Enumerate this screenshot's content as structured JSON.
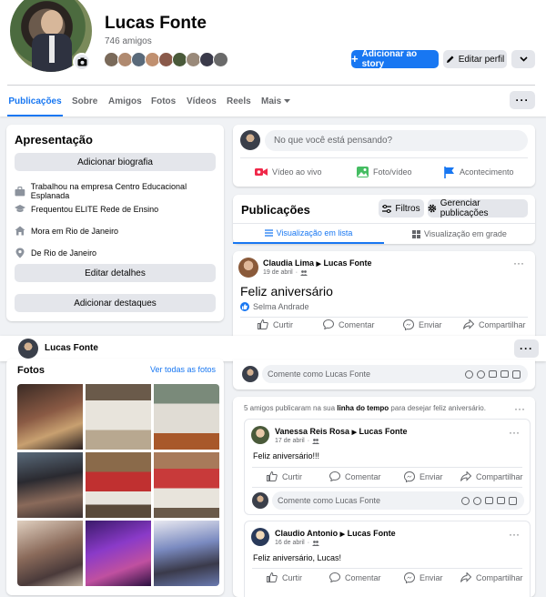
{
  "profile": {
    "name": "Lucas Fonte",
    "friends_count": "746 amigos",
    "add_story_label": "Adicionar ao story",
    "edit_profile_label": "Editar perfil"
  },
  "tabs": [
    "Publicações",
    "Sobre",
    "Amigos",
    "Fotos",
    "Vídeos",
    "Reels",
    "Mais"
  ],
  "intro": {
    "title": "Apresentação",
    "add_bio": "Adicionar biografia",
    "work_prefix": "Trabalhou na empresa",
    "work": "Centro Educacional Esplanada",
    "study_prefix": "Frequentou",
    "study": "ELITE Rede de Ensino",
    "lives_prefix": "Mora em",
    "lives": "Rio de Janeiro",
    "from_prefix": "De",
    "from": "Rio de Janeiro",
    "edit_details": "Editar detalhes",
    "add_highlights": "Adicionar destaques"
  },
  "composer": {
    "placeholder": "No que você está pensando?",
    "live": "Vídeo ao vivo",
    "photo": "Foto/vídeo",
    "event": "Acontecimento"
  },
  "posts_header": {
    "title": "Publicações",
    "filters": "Filtros",
    "manage": "Gerenciar publicações",
    "list_view": "Visualização em lista",
    "grid_view": "Visualização em grade"
  },
  "post1": {
    "author": "Claudia Lima",
    "target": "Lucas Fonte",
    "date": "19 de abril",
    "text": "Feliz aniversário",
    "reaction_by": "Selma Andrade"
  },
  "actions": {
    "like": "Curtir",
    "comment": "Comentar",
    "send": "Enviar",
    "share": "Compartilhar"
  },
  "sticky": {
    "name": "Lucas Fonte"
  },
  "photos": {
    "title": "Fotos",
    "see_all": "Ver todas as fotos"
  },
  "comment_placeholder": "Comente como Lucas Fonte",
  "group_notice": {
    "prefix": "5 amigos publicaram na sua",
    "link": "linha do tempo",
    "suffix": "para desejar feliz aniversário."
  },
  "post2": {
    "author": "Vanessa Reis Rosa",
    "target": "Lucas Fonte",
    "date": "17 de abril",
    "text": "Feliz aniversário!!!"
  },
  "post3": {
    "author": "Claudio Antonio",
    "target": "Lucas Fonte",
    "date": "16 de abril",
    "text": "Feliz aniversário, Lucas!"
  },
  "colors": {
    "accent": "#1877f2",
    "background": "#f0f2f5",
    "live": "#f02849",
    "photo": "#45bd62",
    "event": "#1877f2"
  }
}
